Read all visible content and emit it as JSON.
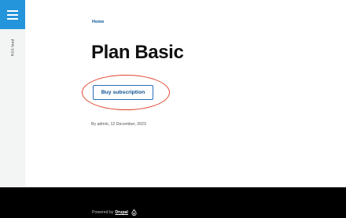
{
  "sidebar": {
    "menu_icon": "hamburger-menu-icon",
    "rss_label": "RSS feed"
  },
  "breadcrumb": {
    "home": "Home"
  },
  "page": {
    "title": "Plan Basic",
    "buy_button_label": "Buy subscription",
    "byline": "By admin, 12 December, 2023"
  },
  "footer": {
    "powered_by": "Powered by",
    "drupal_link": "Drupal",
    "drupal_icon": "drupal-drop-icon"
  },
  "colors": {
    "accent": "#2494db",
    "highlight": "#e0422c",
    "footer_bg": "#000000"
  }
}
